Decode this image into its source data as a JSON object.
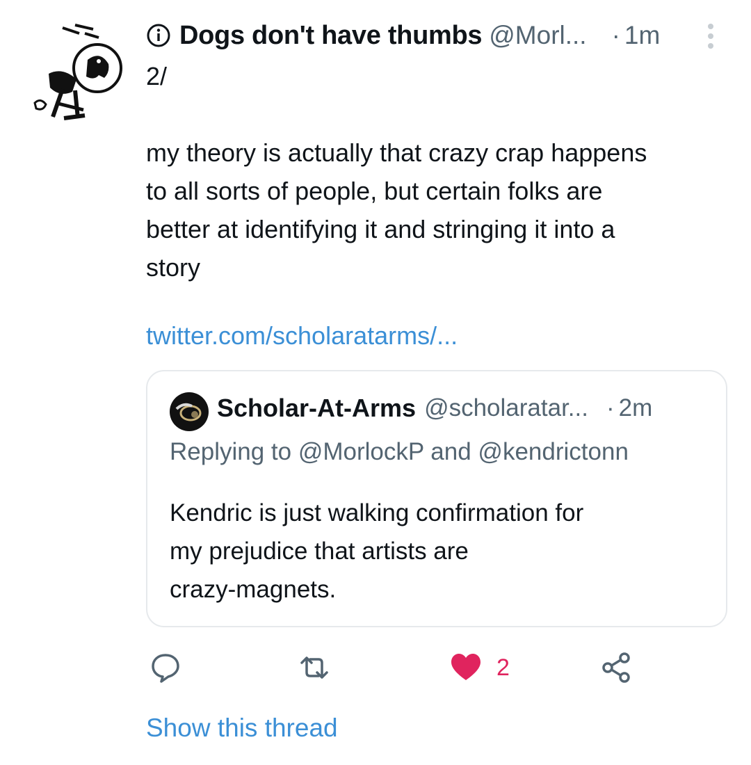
{
  "tweet": {
    "display_name": "Dogs don't have thumbs",
    "handle": "@Morl...",
    "separator": "·",
    "time": "1m",
    "body_lines": [
      "2/",
      "",
      "my theory is actually that crazy crap happens",
      "to all sorts of people, but certain folks are",
      "better at identifying it and stringing it into a",
      "story"
    ],
    "link": "twitter.com/scholaratarms/..."
  },
  "quote": {
    "display_name": "Scholar-At-Arms",
    "handle": "@scholaratar...",
    "separator": "·",
    "time": "2m",
    "replying_to": "Replying to @MorlockP and @kendrictonn",
    "text_lines": [
      "Kendric is just walking confirmation for",
      "my prejudice that artists are",
      "crazy-magnets."
    ]
  },
  "actions": {
    "reply_icon": "reply-icon",
    "retweet_icon": "retweet-icon",
    "like_icon": "heart-icon",
    "like_count": "2",
    "share_icon": "share-icon",
    "like_color": "#e0245e",
    "icon_color": "#536471"
  },
  "show_thread": "Show this thread",
  "colors": {
    "link": "#3b8fd6",
    "text": "#0f1419",
    "secondary": "#536471",
    "border": "#e6e9ec"
  }
}
